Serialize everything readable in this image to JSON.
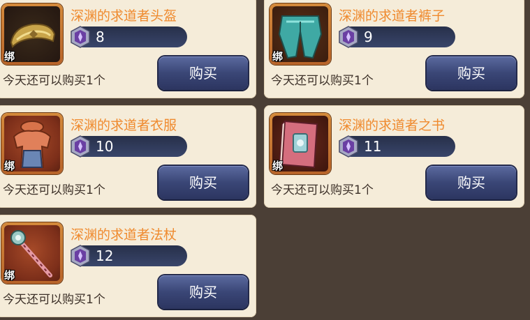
{
  "colors": {
    "background": "#4b3f36",
    "card": "#f5ecd9",
    "item_name": "#ef8a2e",
    "buy_button": "#3a4676"
  },
  "items": [
    {
      "name": "深渊的求道者头盔",
      "icon": "helmet-icon",
      "bind_tag": "绑",
      "level": "8",
      "limit_text": "今天还可以购买1个",
      "buy_label": "购买"
    },
    {
      "name": "深渊的求道者裤子",
      "icon": "pants-icon",
      "bind_tag": "绑",
      "level": "9",
      "limit_text": "今天还可以购买1个",
      "buy_label": "购买"
    },
    {
      "name": "深渊的求道者衣服",
      "icon": "armor-icon",
      "bind_tag": "绑",
      "level": "10",
      "limit_text": "今天还可以购买1个",
      "buy_label": "购买"
    },
    {
      "name": "深渊的求道者之书",
      "icon": "book-icon",
      "bind_tag": "绑",
      "level": "11",
      "limit_text": "今天还可以购买1个",
      "buy_label": "购买"
    },
    {
      "name": "深渊的求道者法杖",
      "icon": "staff-icon",
      "bind_tag": "绑",
      "level": "12",
      "limit_text": "今天还可以购买1个",
      "buy_label": "购买"
    }
  ]
}
